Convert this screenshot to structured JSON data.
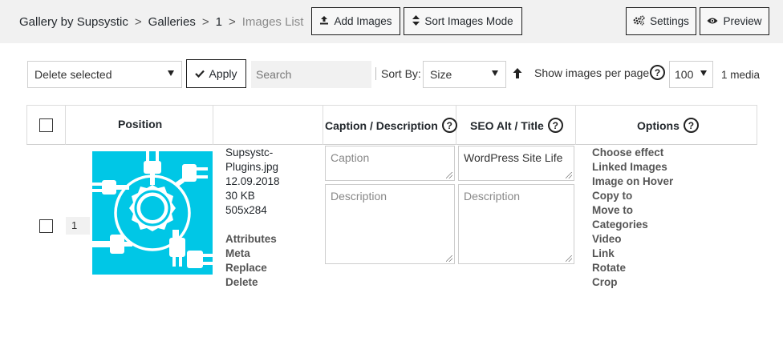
{
  "breadcrumb": [
    "Gallery by Supsystic",
    "Galleries",
    "1",
    "Images List"
  ],
  "toolbar": {
    "add_images": "Add Images",
    "sort_mode": "Sort Images Mode",
    "settings": "Settings",
    "preview": "Preview"
  },
  "filters": {
    "bulk_action": "Delete selected",
    "apply": "Apply",
    "search_placeholder": "Search",
    "sort_by_label": "Sort By:",
    "sort_by_value": "Size",
    "per_page_label": "Show images per page",
    "per_page_value": "100",
    "media_count": "1 media"
  },
  "table": {
    "headers": {
      "position": "Position",
      "caption": "Caption / Description",
      "seo": "SEO Alt / Title",
      "options": "Options"
    },
    "row": {
      "position": "1",
      "filename_line1": "Supsystc-",
      "filename_line2": "Plugins.jpg",
      "date": "12.09.2018",
      "size": "30 KB",
      "dimensions": "505x284",
      "actions": [
        "Attributes",
        "Meta",
        "Replace",
        "Delete"
      ],
      "caption_placeholder": "Caption",
      "description_placeholder": "Description",
      "seo_title": "WordPress Site Life",
      "seo_description_placeholder": "Description",
      "options": [
        "Choose effect",
        "Linked Images",
        "Image on Hover",
        "Copy to",
        "Move to",
        "Categories",
        "Video",
        "Link",
        "Rotate",
        "Crop"
      ]
    }
  },
  "colors": {
    "thumb_bg": "#00c7e6",
    "thumb_fg": "#ffffff"
  }
}
